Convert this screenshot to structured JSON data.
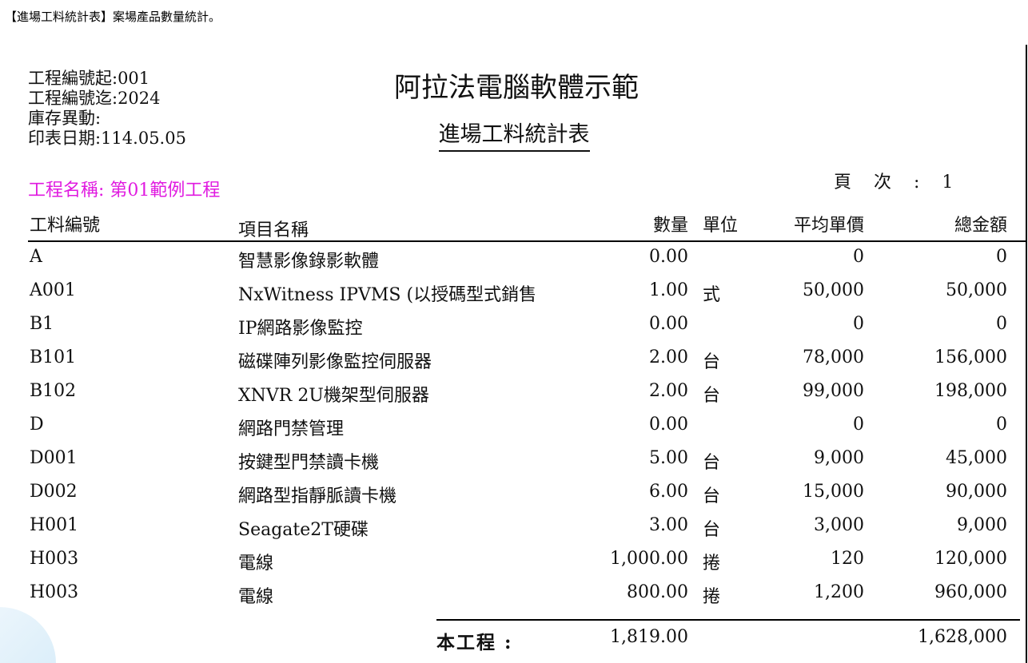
{
  "caption": "【進場工料統計表】案場產品數量統計。",
  "meta": {
    "project_no_from": "工程編號起:001",
    "project_no_to": "工程編號迄:2024",
    "stock_change": "庫存異動:",
    "print_date": "印表日期:114.05.05"
  },
  "company": "阿拉法電腦軟體示範",
  "report_title": "進場工料統計表",
  "project_name": "工程名稱: 第01範例工程",
  "page": {
    "label": "頁次:",
    "number": "1"
  },
  "columns": {
    "code": "工料編號",
    "name": "項目名稱",
    "qty": "數量",
    "unit": "單位",
    "avg_price": "平均單價",
    "total": "總金額"
  },
  "rows": [
    {
      "code": "A",
      "name": "智慧影像錄影軟體",
      "qty": "0.00",
      "unit": "",
      "price": "0",
      "total": "0"
    },
    {
      "code": "A001",
      "name": "NxWitness IPVMS (以授碼型式銷售",
      "qty": "1.00",
      "unit": "式",
      "price": "50,000",
      "total": "50,000"
    },
    {
      "code": "B1",
      "name": "IP網路影像監控",
      "qty": "0.00",
      "unit": "",
      "price": "0",
      "total": "0"
    },
    {
      "code": "B101",
      "name": "磁碟陣列影像監控伺服器",
      "qty": "2.00",
      "unit": "台",
      "price": "78,000",
      "total": "156,000"
    },
    {
      "code": "B102",
      "name": "XNVR 2U機架型伺服器",
      "qty": "2.00",
      "unit": "台",
      "price": "99,000",
      "total": "198,000"
    },
    {
      "code": "D",
      "name": "網路門禁管理",
      "qty": "0.00",
      "unit": "",
      "price": "0",
      "total": "0"
    },
    {
      "code": "D001",
      "name": "按鍵型門禁讀卡機",
      "qty": "5.00",
      "unit": "台",
      "price": "9,000",
      "total": "45,000"
    },
    {
      "code": "D002",
      "name": "網路型指靜脈讀卡機",
      "qty": "6.00",
      "unit": "台",
      "price": "15,000",
      "total": "90,000"
    },
    {
      "code": "H001",
      "name": "Seagate2T硬碟",
      "qty": "3.00",
      "unit": "台",
      "price": "3,000",
      "total": "9,000"
    },
    {
      "code": "H003",
      "name": "電線",
      "qty": "1,000.00",
      "unit": "捲",
      "price": "120",
      "total": "120,000"
    },
    {
      "code": "H003",
      "name": "電線",
      "qty": "800.00",
      "unit": "捲",
      "price": "1,200",
      "total": "960,000"
    }
  ],
  "summary": {
    "label": "本工程 :",
    "qty": "1,819.00",
    "total": "1,628,000"
  },
  "colors": {
    "project_name": "#e01ae0",
    "text": "#111111",
    "rule": "#000000"
  }
}
